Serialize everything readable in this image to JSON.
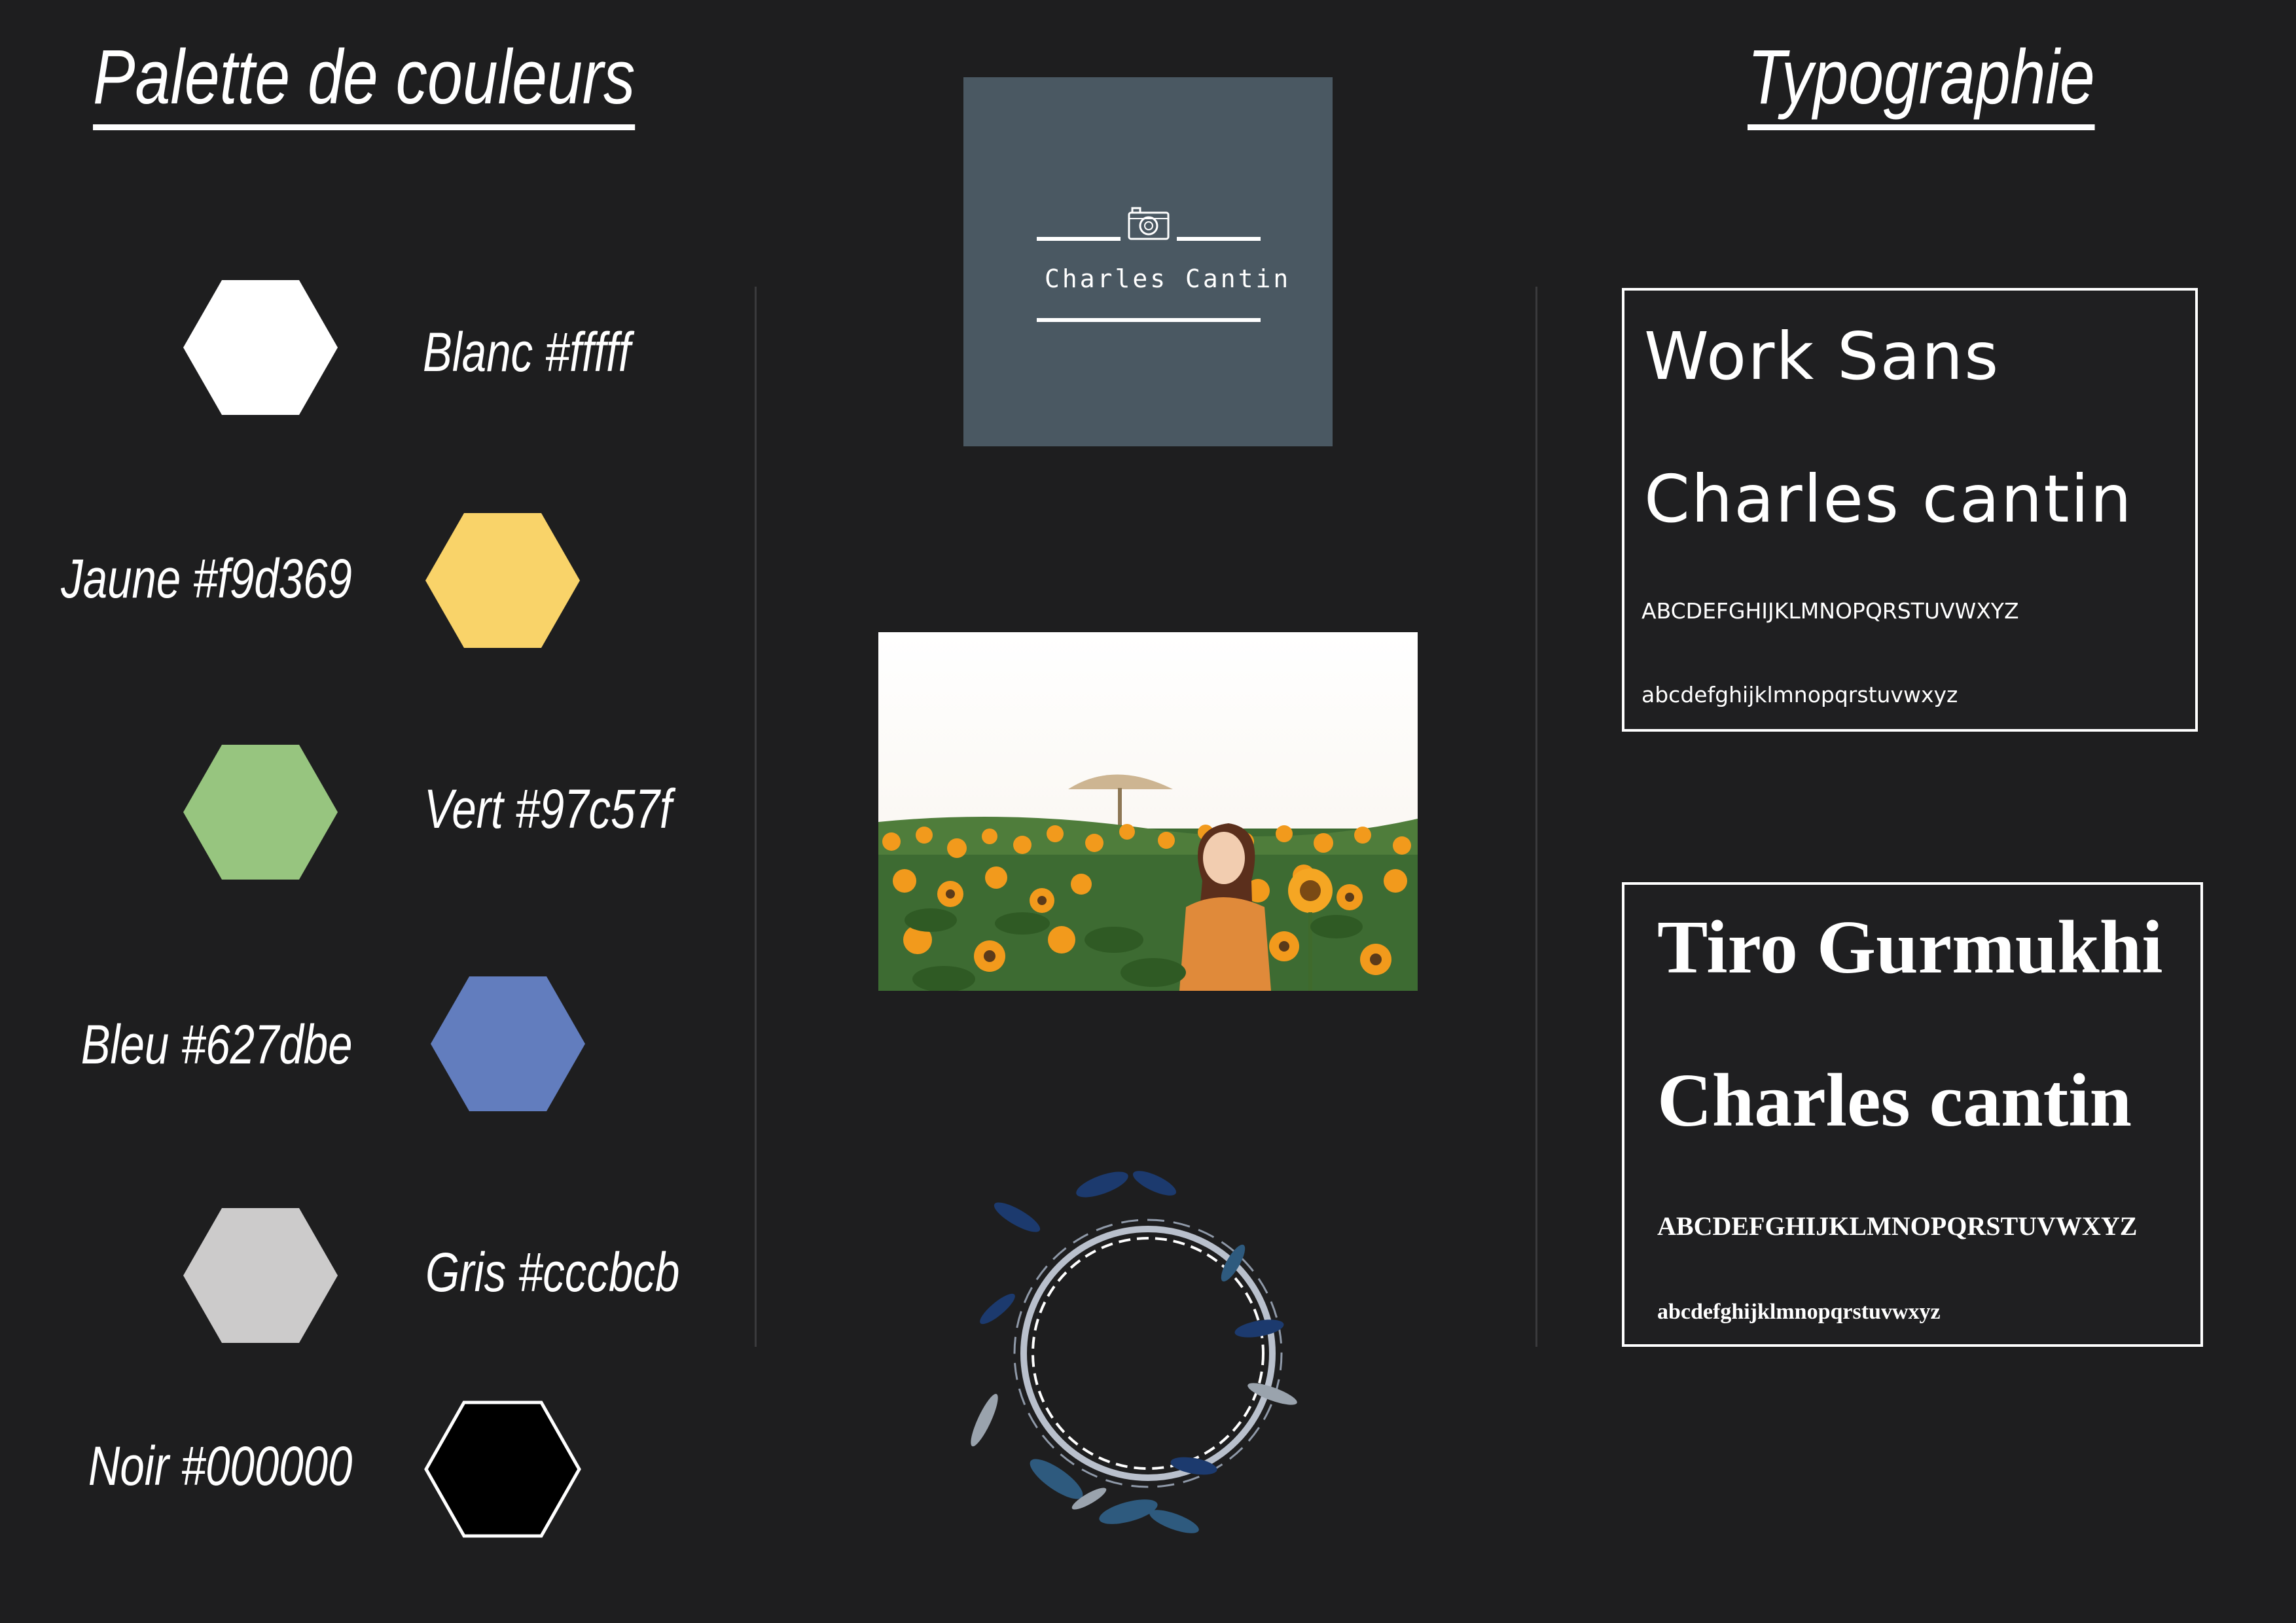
{
  "palette": {
    "title": "Palette de couleurs",
    "swatches": [
      {
        "label": "Blanc #fffff",
        "color": "#ffffff"
      },
      {
        "label": "Jaune #f9d369",
        "color": "#f9d369"
      },
      {
        "label": "Vert #97c57f",
        "color": "#97c57f"
      },
      {
        "label": "Bleu  #627dbe",
        "color": "#627dbe"
      },
      {
        "label": "Gris #cccbcb",
        "color": "#cccbcb"
      },
      {
        "label": "Noir #000000",
        "color": "#000000"
      }
    ]
  },
  "logo": {
    "name": "Charles Cantin",
    "background": "#4a5862",
    "icon": "camera-icon"
  },
  "photo": {
    "subject": "sunflower-field-photo"
  },
  "wreath": {
    "icon": "floral-wreath-icon"
  },
  "typography": {
    "title": "Typographie",
    "fonts": [
      {
        "name": "Work Sans",
        "sample": "Charles cantin",
        "uppercase": "ABCDEFGHIJKLMNOPQRSTUVWXYZ",
        "lowercase": "abcdefghijklmnopqrstuvwxyz"
      },
      {
        "name": "Tiro Gurmukhi",
        "sample": "Charles cantin",
        "uppercase": "ABCDEFGHIJKLMNOPQRSTUVWXYZ",
        "lowercase": "abcdefghijklmnopqrstuvwxyz"
      }
    ]
  }
}
